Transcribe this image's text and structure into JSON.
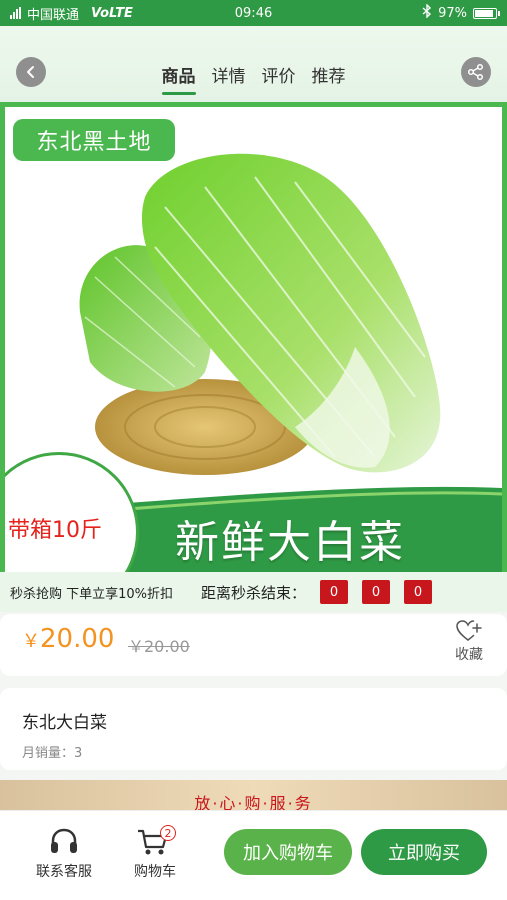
{
  "status_bar": {
    "carrier": "中国联通",
    "network": "VoLTE",
    "time": "09:46",
    "battery": "97%",
    "battery_level": 0.97
  },
  "header": {
    "tabs": [
      "商品",
      "详情",
      "评价",
      "推荐"
    ],
    "active_tab": 0,
    "icons": {
      "back": "chevron-left-icon",
      "share": "share-icon"
    }
  },
  "hero": {
    "origin_tag": "东北黑土地",
    "title": "新鲜大白菜",
    "box_badge": "带箱10斤",
    "colors": {
      "frame": "#4bb84f",
      "band": "#2f9a45"
    }
  },
  "flash_sale": {
    "promo": "秒杀抢购 下单立享10%折扣",
    "countdown_label": "距离秒杀结束：",
    "countdown": [
      "0",
      "0",
      "0"
    ]
  },
  "price": {
    "currency": "￥",
    "amount": "20.00",
    "original": "￥20.00",
    "favorite_label": "收藏"
  },
  "product": {
    "name": "东北大白菜",
    "sales": "月销量：3"
  },
  "assurance": {
    "text": "放·心·购·服·务"
  },
  "bottom_bar": {
    "service_label": "联系客服",
    "cart_label": "购物车",
    "cart_count": "2",
    "add_to_cart": "加入购物车",
    "buy_now": "立即购买"
  },
  "colors": {
    "brand_green": "#2f9a45",
    "price_orange": "#f39321",
    "sale_red": "#c8161d"
  }
}
